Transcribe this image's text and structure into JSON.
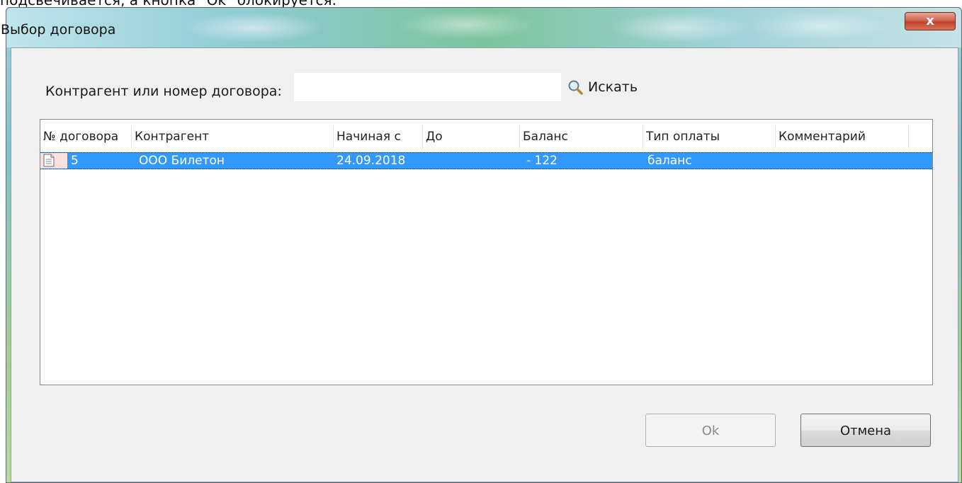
{
  "page_caption_cut": "подсвечивается, а кнопка \"Ok\" блокируется.",
  "window": {
    "title": "Выбор договора",
    "close_label": "x"
  },
  "search": {
    "label": "Контрагент или номер договора:",
    "value": "",
    "button_label": "Искать"
  },
  "table": {
    "columns": [
      "№ договора",
      "Контрагент",
      "Начиная с",
      "До",
      "Баланс",
      "Тип оплаты",
      "Комментарий"
    ],
    "rows": [
      {
        "number": "5",
        "counterparty": "ООО Билетон",
        "start": "24.09.2018",
        "end": "",
        "balance": "- 122",
        "payment_type": "баланс",
        "comment": "",
        "selected": true
      }
    ]
  },
  "buttons": {
    "ok_label": "Ok",
    "ok_enabled": false,
    "cancel_label": "Отмена"
  },
  "colors": {
    "selection": "#3399ff",
    "dialog_bg": "#f0f0f0",
    "close_button": "#c2412a"
  },
  "icons": {
    "search": "magnifier-icon",
    "row": "document-icon",
    "close": "close-icon"
  }
}
